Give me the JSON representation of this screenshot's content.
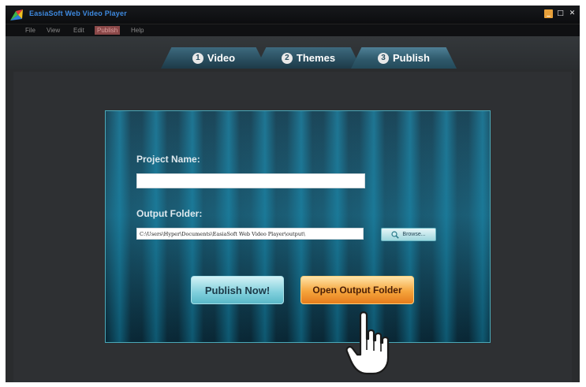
{
  "window": {
    "title": "EasiaSoft Web Video Player",
    "controls": {
      "minimize": "_",
      "maximize": "□",
      "close": "✕"
    }
  },
  "menu": {
    "items": [
      "File",
      "View",
      "Edit",
      "Publish",
      "Help"
    ],
    "active_index": 3
  },
  "tabs": [
    {
      "number": "1",
      "label": "Video"
    },
    {
      "number": "2",
      "label": "Themes"
    },
    {
      "number": "3",
      "label": "Publish"
    }
  ],
  "form": {
    "project_name_label": "Project Name:",
    "project_name_value": "",
    "output_folder_label": "Output Folder:",
    "output_folder_value": "C:\\Users\\Hyper\\Documents\\EasiaSoft Web Video Player\\output\\",
    "browse_label": "Browse...",
    "publish_now_label": "Publish Now!",
    "open_output_label": "Open Output Folder"
  },
  "icons": {
    "app_logo": "app-logo-icon",
    "browse": "magnifier-icon",
    "cursor": "hand-pointer-icon"
  },
  "colors": {
    "accent_blue": "#3e8ae0",
    "tab_teal": "#2a4f60",
    "publish_button": "#7fcfdc",
    "open_button": "#f5a43c"
  }
}
